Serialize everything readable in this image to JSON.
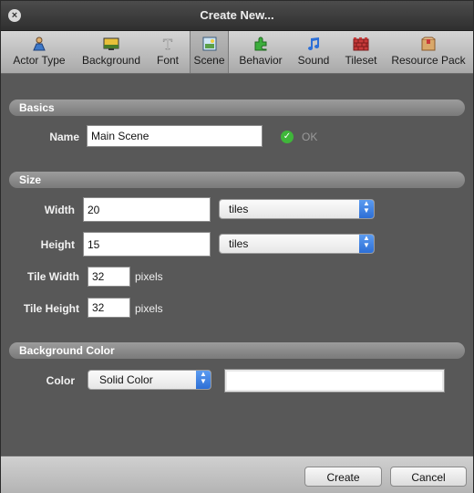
{
  "window": {
    "title": "Create New..."
  },
  "toolbar": {
    "items": [
      {
        "label": "Actor Type",
        "icon": "actor-icon"
      },
      {
        "label": "Background",
        "icon": "background-icon"
      },
      {
        "label": "Font",
        "icon": "font-icon"
      },
      {
        "label": "Scene",
        "icon": "scene-icon",
        "active": true
      },
      {
        "label": "Behavior",
        "icon": "behavior-icon"
      },
      {
        "label": "Sound",
        "icon": "sound-icon"
      },
      {
        "label": "Tileset",
        "icon": "tileset-icon"
      },
      {
        "label": "Resource Pack",
        "icon": "resource-pack-icon"
      }
    ]
  },
  "basics": {
    "header": "Basics",
    "name_label": "Name",
    "name_value": "Main Scene",
    "ok_label": "OK"
  },
  "size": {
    "header": "Size",
    "width_label": "Width",
    "width_value": "20",
    "width_unit": "tiles",
    "height_label": "Height",
    "height_value": "15",
    "height_unit": "tiles",
    "tile_width_label": "Tile Width",
    "tile_width_value": "32",
    "tile_width_unit": "pixels",
    "tile_height_label": "Tile Height",
    "tile_height_value": "32",
    "tile_height_unit": "pixels"
  },
  "background": {
    "header": "Background Color",
    "color_label": "Color",
    "color_mode": "Solid Color",
    "color_value": "#ffffff"
  },
  "footer": {
    "create_label": "Create",
    "cancel_label": "Cancel"
  }
}
